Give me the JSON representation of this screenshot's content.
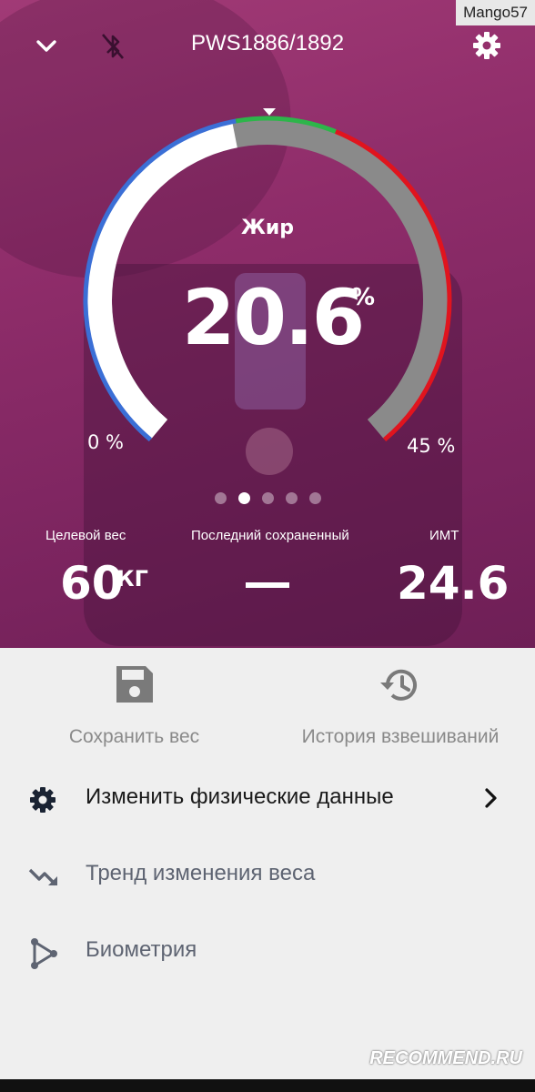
{
  "watermark": "Mango57",
  "header": {
    "title": "PWS1886/1892",
    "back_icon": "chevron-down-icon",
    "bluetooth_icon": "bluetooth-off-icon",
    "settings_icon": "gear-icon"
  },
  "gauge": {
    "label": "Жир",
    "value": "20.6",
    "unit": "%",
    "min_label": "0 %",
    "max_label": "45 %",
    "fill_fraction": 0.46,
    "colors": {
      "low": "#3b6fd6",
      "normal": "#2db54a",
      "high": "#e0141e",
      "track": "#8a8a8a",
      "fill": "#ffffff"
    }
  },
  "pager": {
    "count": 5,
    "active_index": 1
  },
  "stats": {
    "target_weight": {
      "label": "Целевой вес",
      "value": "60",
      "unit": "КГ"
    },
    "last_saved": {
      "label": "Последний сохраненный",
      "value": "—"
    },
    "bmi": {
      "label": "ИМТ",
      "value": "24.6"
    }
  },
  "actions": {
    "save": {
      "label": "Сохранить вес",
      "icon": "floppy-disk-icon"
    },
    "history": {
      "label": "История взвешиваний",
      "icon": "history-icon"
    }
  },
  "menu": [
    {
      "label": "Изменить физические данные",
      "icon": "gear-icon",
      "active": true
    },
    {
      "label": "Тренд изменения веса",
      "icon": "trend-down-icon",
      "active": false
    },
    {
      "label": "Биометрия",
      "icon": "biometry-icon",
      "active": false
    }
  ],
  "footer_watermark": "RECOMMEND.RU"
}
